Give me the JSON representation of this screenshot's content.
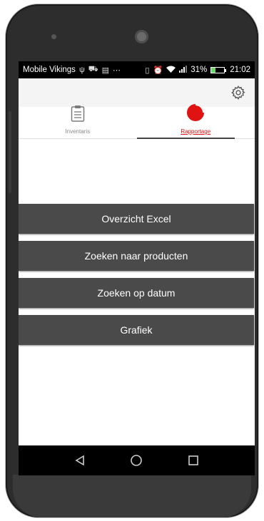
{
  "statusbar": {
    "carrier": "Mobile Vikings",
    "battery_percent": "31%",
    "battery_level": 0.31,
    "time": "21:02",
    "icons_left": [
      "usb-icon",
      "car-icon",
      "image-icon",
      "more-icon"
    ],
    "icons_right": [
      "vibrate-icon",
      "alarm-icon",
      "wifi-icon",
      "signal-icon",
      "battery-icon"
    ]
  },
  "toolbar": {
    "settings_icon": "gear-icon"
  },
  "tabs": [
    {
      "label": "Inventaris",
      "icon": "clipboard-icon",
      "active": false
    },
    {
      "label": "Rapportage",
      "icon": "pie-chart-icon",
      "active": true
    }
  ],
  "menu": {
    "items": [
      {
        "label": "Overzicht Excel"
      },
      {
        "label": "Zoeken naar producten"
      },
      {
        "label": "Zoeken op datum"
      },
      {
        "label": "Grafiek"
      }
    ]
  },
  "navbar": {
    "back": "back-icon",
    "home": "home-icon",
    "recents": "recents-icon"
  },
  "colors": {
    "accent": "#e01212",
    "button_bg": "#4a4a4a",
    "button_text": "#ffffff",
    "statusbar_bg": "#000000"
  }
}
